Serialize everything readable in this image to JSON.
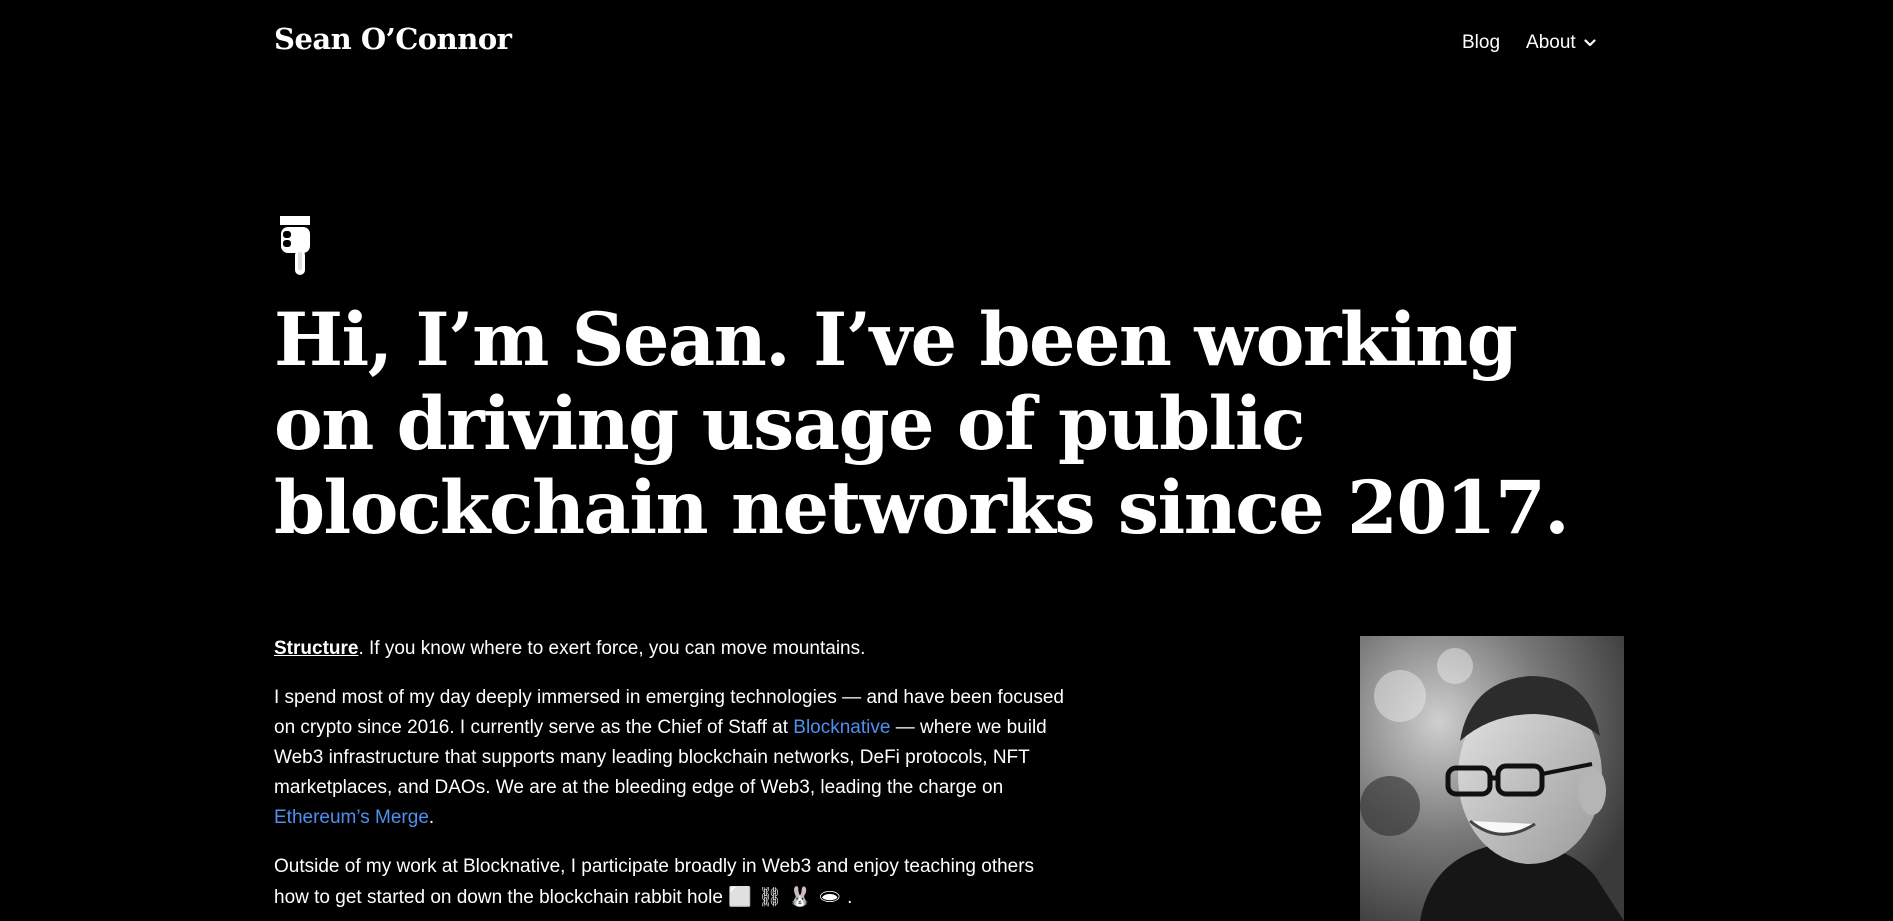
{
  "header": {
    "site_title": "Sean O’Connor",
    "nav": {
      "blog_label": "Blog",
      "about_label": "About",
      "about_icon": "chevron-down-icon"
    }
  },
  "hero": {
    "icon": "pointing-down-hand-icon",
    "headline": "Hi, I’m Sean. I’ve been working on driving usage of public blockchain networks since 2017."
  },
  "bio": {
    "p1": {
      "structure_link": "Structure",
      "text": ". If you know where to exert force, you can move mountains."
    },
    "p2": {
      "text_a": "I spend most of my day deeply immersed in emerging technologies — and have been focused on crypto since 2016. I currently serve as the Chief of Staff at ",
      "blocknative_link": "Blocknative",
      "text_b": " — where we build Web3 infrastructure that supports many leading blockchain networks, DeFi protocols, NFT marketplaces, and DAOs. We are at the bleeding edge of Web3, leading the charge on ",
      "merge_link": "Ethereum’s Merge",
      "text_c": "."
    },
    "p3": {
      "text_a": "Outside of my work at Blocknative, I participate broadly in Web3 and enjoy teaching others how to get started on down the blockchain rabbit hole ",
      "emojis": "⬜ ⛓ 🐰 🕳",
      "text_b": " ."
    }
  },
  "portrait": {
    "icon": "portrait-photo"
  },
  "colors": {
    "background": "#000000",
    "text": "#ffffff",
    "link": "#4f8ff0"
  }
}
